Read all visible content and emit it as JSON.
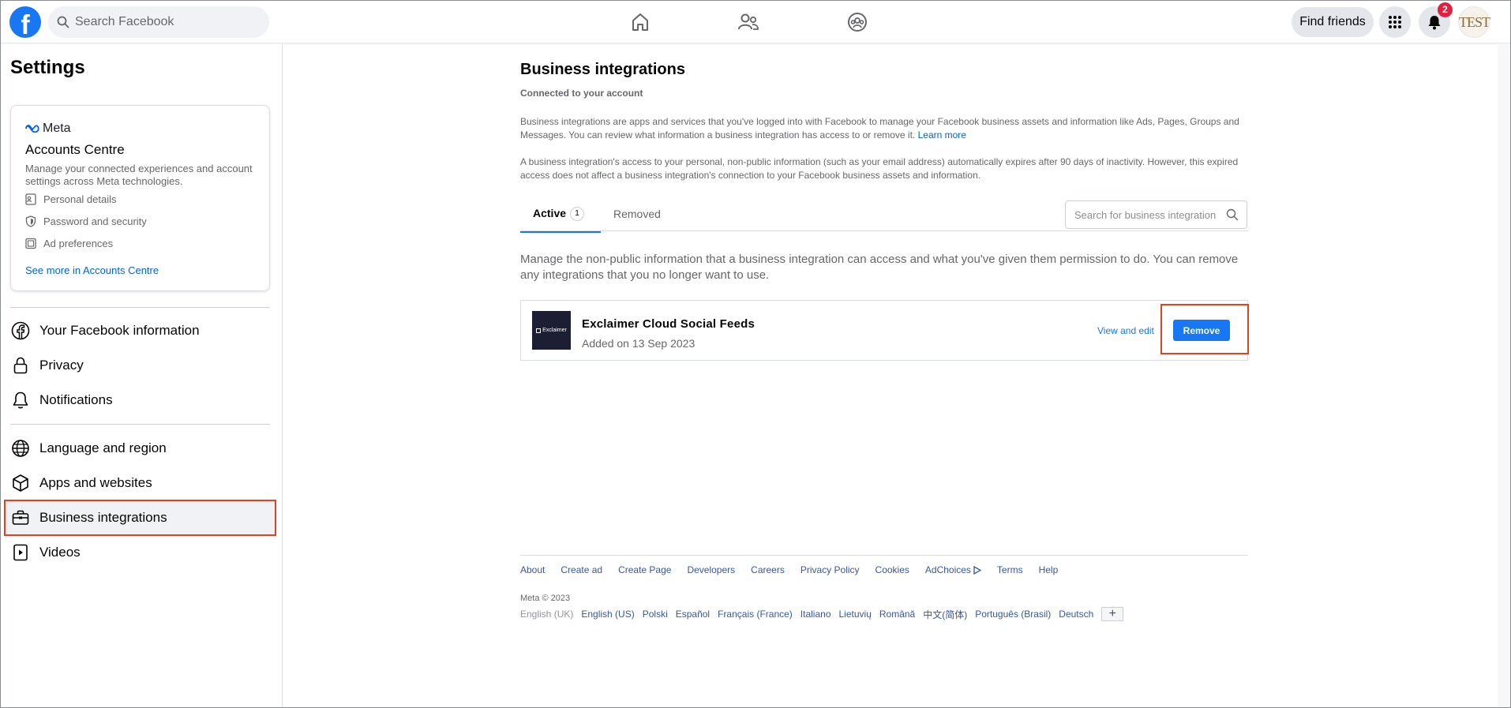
{
  "topbar": {
    "logo": "f",
    "search_placeholder": "Search Facebook",
    "find_friends": "Find friends",
    "notification_count": "2",
    "avatar_text": "TEST",
    "icons": [
      "home-icon",
      "friends-icon",
      "groups-icon",
      "menu-grid-icon",
      "bell-icon"
    ]
  },
  "sidebar": {
    "title": "Settings",
    "accounts_centre": {
      "brand": "Meta",
      "title": "Accounts Centre",
      "description": "Manage your connected experiences and account settings across Meta technologies.",
      "items": [
        {
          "label": "Personal details",
          "icon": "id-card-icon"
        },
        {
          "label": "Password and security",
          "icon": "shield-icon"
        },
        {
          "label": "Ad preferences",
          "icon": "ad-icon"
        }
      ],
      "link": "See more in Accounts Centre"
    },
    "items": [
      {
        "label": "Your Facebook information",
        "icon": "facebook-icon"
      },
      {
        "label": "Privacy",
        "icon": "lock-icon"
      },
      {
        "label": "Notifications",
        "icon": "bell-icon"
      },
      {
        "label": "Language and region",
        "icon": "globe-icon"
      },
      {
        "label": "Apps and websites",
        "icon": "cube-icon"
      },
      {
        "label": "Business integrations",
        "icon": "briefcase-icon",
        "active": true
      },
      {
        "label": "Videos",
        "icon": "video-icon"
      }
    ]
  },
  "main": {
    "title": "Business integrations",
    "subtitle": "Connected to your account",
    "para1": "Business integrations are apps and services that you've logged into with Facebook to manage your Facebook business assets and information like Ads, Pages, Groups and Messages. You can review what information a business integration has access to or remove it.",
    "para1_link": "Learn more",
    "para2": "A business integration's access to your personal, non-public information (such as your email address) automatically expires after 90 days of inactivity. However, this expired access does not affect a business integration's connection to your Facebook business assets and information.",
    "tabs": [
      {
        "label": "Active",
        "count": "1"
      },
      {
        "label": "Removed"
      }
    ],
    "search_placeholder": "Search for business integrations",
    "manage_text": "Manage the non-public information that a business integration can access and what you've given them permission to do. You can remove any integrations that you no longer want to use.",
    "integration": {
      "logo_text": "Exclaimer",
      "name": "Exclaimer Cloud Social Feeds",
      "date": "Added on 13 Sep 2023",
      "view_edit": "View and edit",
      "remove": "Remove"
    }
  },
  "footer": {
    "links": [
      "About",
      "Create ad",
      "Create Page",
      "Developers",
      "Careers",
      "Privacy Policy",
      "Cookies",
      "AdChoices",
      "Terms",
      "Help"
    ],
    "copyright": "Meta © 2023",
    "languages": [
      "English (UK)",
      "English (US)",
      "Polski",
      "Español",
      "Français (France)",
      "Italiano",
      "Lietuvių",
      "Română",
      "中文(简体)",
      "Português (Brasil)",
      "Deutsch"
    ],
    "plus": "+"
  },
  "colors": {
    "brand": "#1877f2",
    "highlight": "#e0431f",
    "badge": "#e41e3f"
  }
}
